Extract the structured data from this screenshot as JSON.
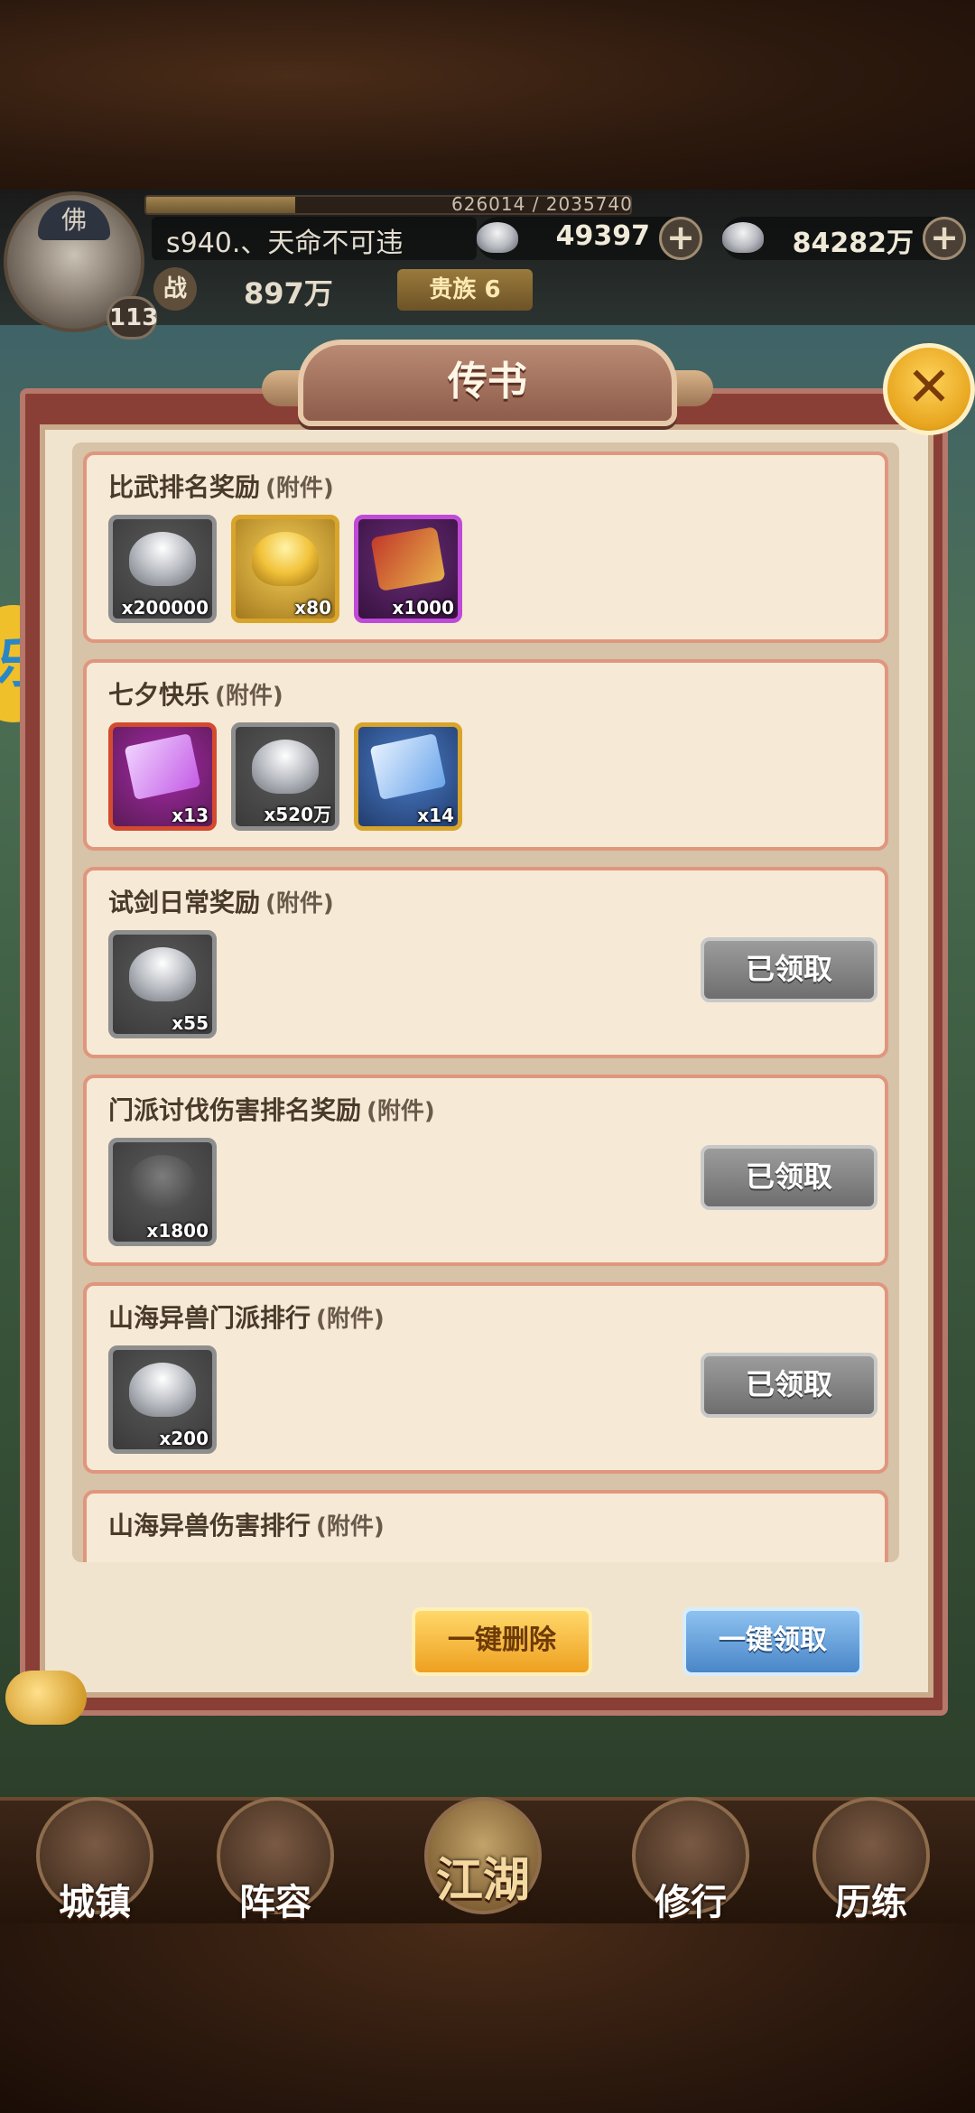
{
  "header": {
    "exp_text": "626014 / 2035740",
    "exp_fraction": 0.307,
    "player_name": "s940.、天命不可违",
    "avatar_cap": "佛",
    "level": "113",
    "silver": "49397",
    "silver_plus": "+",
    "ingot": "84282万",
    "ingot_plus": "+",
    "power_icon": "战",
    "power": "897万",
    "noble": "贵族 6"
  },
  "side_badge": "乐",
  "dialog": {
    "title": "传书",
    "close_icon": "✕"
  },
  "mails": [
    {
      "title": "比武排名奖励",
      "tag": "(附件)",
      "items": [
        {
          "type": "silver",
          "count": "x200000"
        },
        {
          "type": "gold",
          "count": "x80"
        },
        {
          "type": "card",
          "count": "x1000"
        }
      ],
      "claimed": null
    },
    {
      "title": "七夕快乐",
      "tag": "(附件)",
      "items": [
        {
          "type": "scroll-purple",
          "count": "x13"
        },
        {
          "type": "silver",
          "count": "x520万"
        },
        {
          "type": "scroll-blue",
          "count": "x14"
        }
      ],
      "claimed": null
    },
    {
      "title": "试剑日常奖励",
      "tag": "(附件)",
      "items": [
        {
          "type": "silver",
          "count": "x55"
        }
      ],
      "claimed": "已领取"
    },
    {
      "title": "门派讨伐伤害排名奖励",
      "tag": "(附件)",
      "items": [
        {
          "type": "token",
          "count": "x1800"
        }
      ],
      "claimed": "已领取"
    },
    {
      "title": "山海异兽门派排行",
      "tag": "(附件)",
      "items": [
        {
          "type": "silver",
          "count": "x200"
        }
      ],
      "claimed": "已领取"
    },
    {
      "title": "山海异兽伤害排行",
      "tag": "(附件)",
      "items": [],
      "claimed": null
    }
  ],
  "buttons": {
    "delete_all": "一键删除",
    "claim_all": "一键领取"
  },
  "nav": [
    {
      "label": "城镇",
      "icon": "town-icon"
    },
    {
      "label": "阵容",
      "icon": "lineup-icon"
    },
    {
      "label": "江湖",
      "icon": "jianghu-icon"
    },
    {
      "label": "修行",
      "icon": "cultivate-icon"
    },
    {
      "label": "历练",
      "icon": "training-icon"
    }
  ]
}
